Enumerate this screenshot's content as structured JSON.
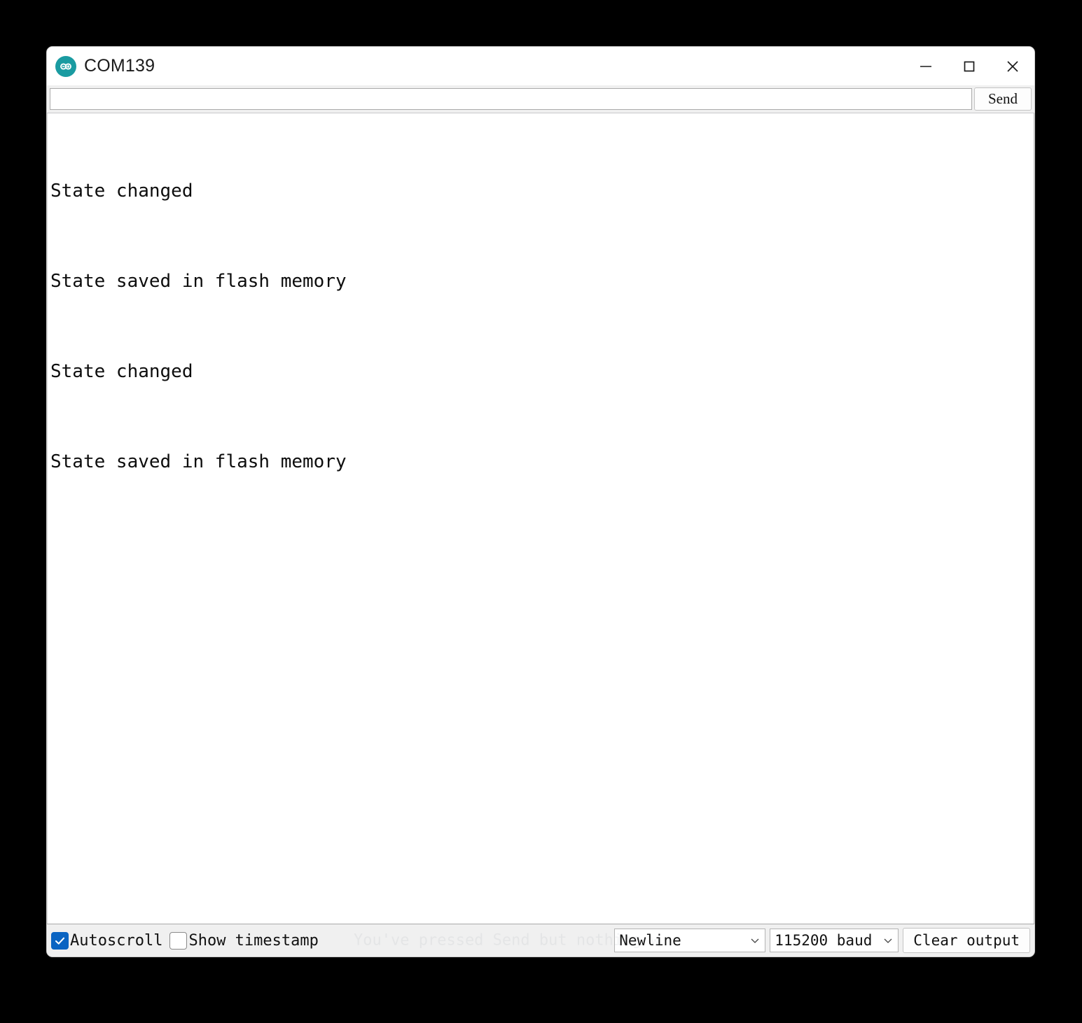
{
  "window": {
    "title": "COM139",
    "logo_icon": "arduino-infinity-icon",
    "logo_color": "#1a9ba1",
    "controls": [
      {
        "name": "minimize",
        "icon": "minimize-icon"
      },
      {
        "name": "maximize",
        "icon": "maximize-icon"
      },
      {
        "name": "close",
        "icon": "close-icon"
      }
    ]
  },
  "send_row": {
    "input_value": "",
    "input_placeholder": "",
    "send_label": "Send"
  },
  "output": {
    "lines": [
      "State changed",
      "State saved in flash memory",
      "State changed",
      "State saved in flash memory"
    ]
  },
  "bottom_bar": {
    "autoscroll": {
      "label": "Autoscroll",
      "checked": true,
      "check_icon": "check-icon",
      "accent_color": "#0a64c2"
    },
    "show_timestamp": {
      "label": "Show timestamp",
      "checked": false
    },
    "ghost_hint": "You've pressed Send but nothing w",
    "line_ending": {
      "selected": "Newline",
      "chevron_icon": "chevron-down-icon"
    },
    "baud_rate": {
      "selected": "115200 baud",
      "chevron_icon": "chevron-down-icon"
    },
    "clear_output_label": "Clear output"
  }
}
